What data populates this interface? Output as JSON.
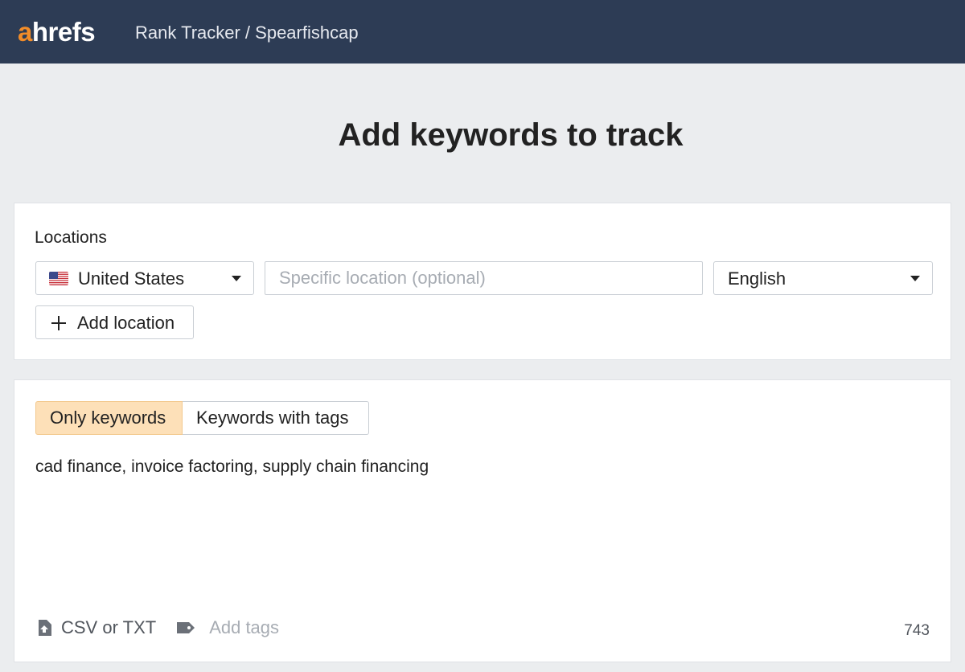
{
  "header": {
    "logo_prefix": "a",
    "logo_rest": "hrefs",
    "breadcrumb": "Rank Tracker / Spearfishcap"
  },
  "page": {
    "title": "Add keywords to track"
  },
  "locations": {
    "label": "Locations",
    "country": "United States",
    "country_flag": "us-flag-icon",
    "specific_placeholder": "Specific location (optional)",
    "language": "English",
    "add_location_label": "Add location"
  },
  "keywords": {
    "tab_only": "Only keywords",
    "tab_with_tags": "Keywords with tags",
    "active_tab": "Only keywords",
    "text": "cad finance, invoice factoring, supply chain financing",
    "csv_label": "CSV or TXT",
    "add_tags_label": "Add tags",
    "char_count": "743"
  },
  "colors": {
    "header_bg": "#2d3c55",
    "logo_accent": "#f28c28",
    "active_tab_bg": "#fde0b8",
    "page_bg": "#ebedef"
  }
}
